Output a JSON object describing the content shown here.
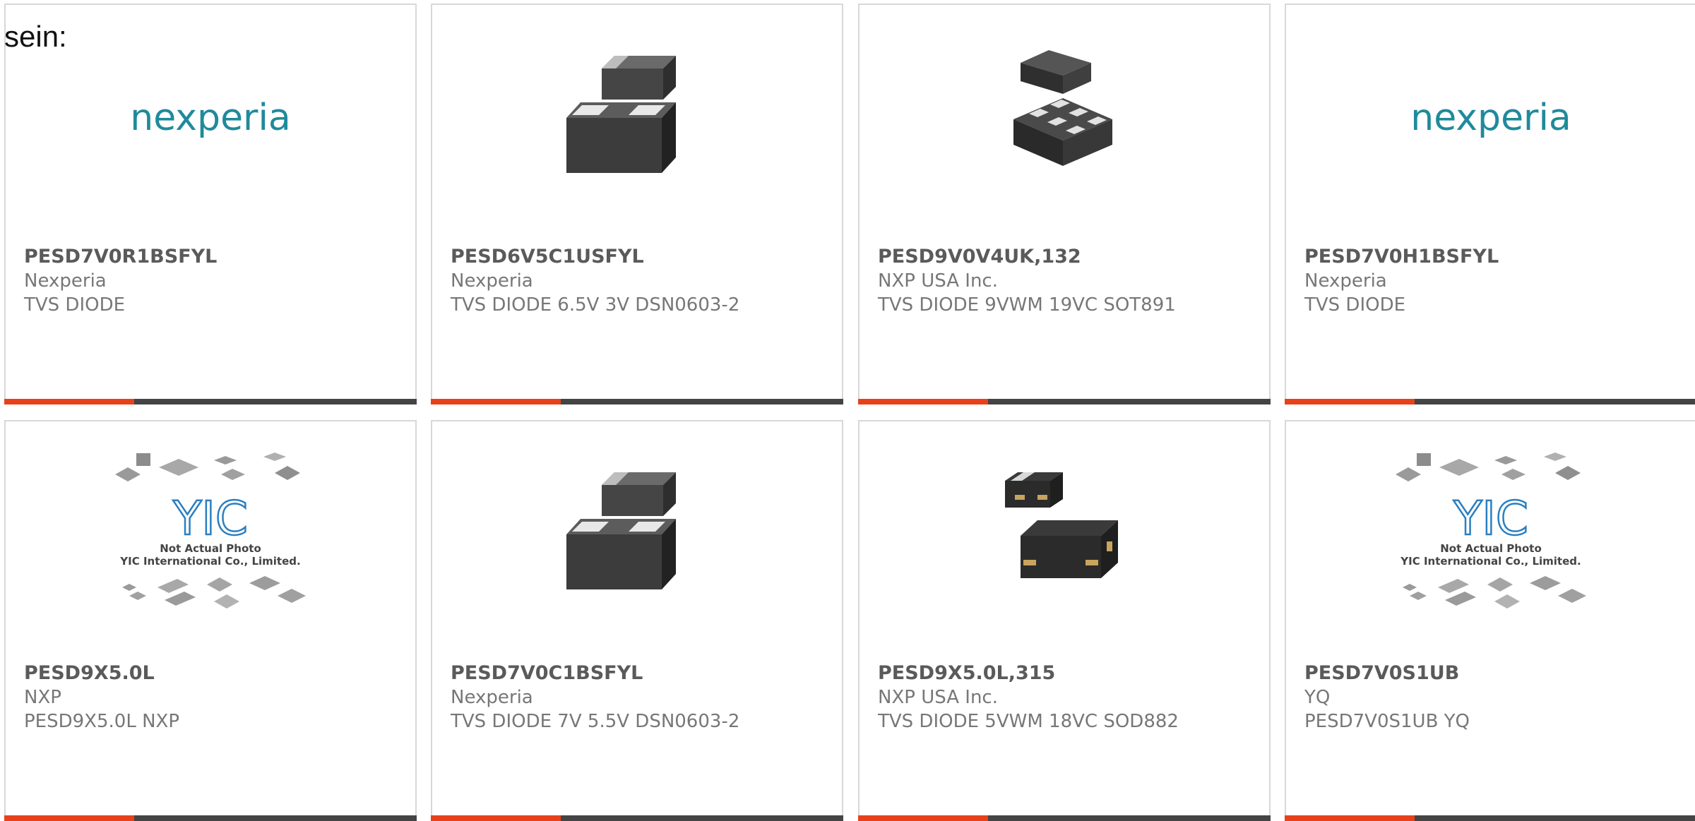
{
  "lead_text": "sein:",
  "colors": {
    "accent": "#e8411a",
    "bar": "#444444",
    "nexperia_brand": "#1f8a9b",
    "yic_brand": "#2b7fc0"
  },
  "products": [
    {
      "part_number": "PESD7V0R1BSFYL",
      "manufacturer": "Nexperia",
      "description": "TVS DIODE",
      "image": {
        "kind": "logo",
        "logo_text": "nexperia"
      }
    },
    {
      "part_number": "PESD6V5C1USFYL",
      "manufacturer": "Nexperia",
      "description": "TVS DIODE 6.5V 3V DSN0603-2",
      "image": {
        "kind": "package-dsn0603-2"
      }
    },
    {
      "part_number": "PESD9V0V4UK,132",
      "manufacturer": "NXP USA Inc.",
      "description": "TVS DIODE 9VWM 19VC SOT891",
      "image": {
        "kind": "package-sot891"
      }
    },
    {
      "part_number": "PESD7V0H1BSFYL",
      "manufacturer": "Nexperia",
      "description": "TVS DIODE",
      "image": {
        "kind": "logo",
        "logo_text": "nexperia"
      }
    },
    {
      "part_number": "PESD9X5.0L",
      "manufacturer": "NXP",
      "description": "PESD9X5.0L NXP",
      "image": {
        "kind": "placeholder",
        "logo_text": "YIC",
        "caption_line1": "Not Actual Photo",
        "caption_line2": "YIC International Co., Limited."
      }
    },
    {
      "part_number": "PESD7V0C1BSFYL",
      "manufacturer": "Nexperia",
      "description": "TVS DIODE 7V 5.5V DSN0603-2",
      "image": {
        "kind": "package-dsn0603-2"
      }
    },
    {
      "part_number": "PESD9X5.0L,315",
      "manufacturer": "NXP USA Inc.",
      "description": "TVS DIODE 5VWM 18VC SOD882",
      "image": {
        "kind": "package-sod882"
      }
    },
    {
      "part_number": "PESD7V0S1UB",
      "manufacturer": "YQ",
      "description": "PESD7V0S1UB YQ",
      "image": {
        "kind": "placeholder",
        "logo_text": "YIC",
        "caption_line1": "Not Actual Photo",
        "caption_line2": "YIC International Co., Limited."
      }
    }
  ]
}
